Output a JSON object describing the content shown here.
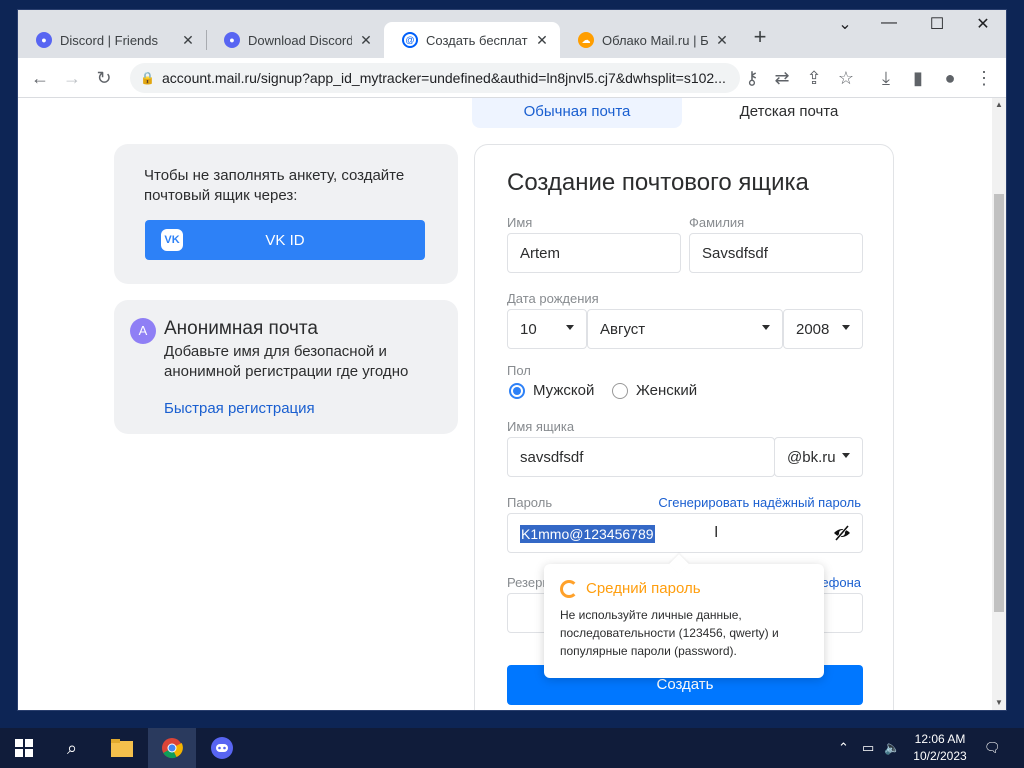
{
  "browser": {
    "tabs": [
      {
        "label": "Discord | Friends",
        "icon": "discord-icon",
        "color": "#5865f2"
      },
      {
        "label": "Download Discord fo",
        "icon": "discord-icon",
        "color": "#5865f2"
      },
      {
        "label": "Создать бесплатну",
        "icon": "mailru-at-icon",
        "color": "#005ff9",
        "active": true
      },
      {
        "label": "Облако Mail.ru | Бе",
        "icon": "cloud-icon",
        "color": "#ff9e00"
      }
    ],
    "new_tab": "+",
    "url": "account.mail.ru/signup?app_id_mytracker=undefined&authid=ln8jnvl5.cj7&dwhsplit=s102..."
  },
  "kind_tabs": {
    "regular": "Обычная почта",
    "kids": "Детская почта"
  },
  "vk_card": {
    "text": "Чтобы не заполнять анкету, создайте почтовый ящик через:",
    "button": "VK ID",
    "logo": "VK"
  },
  "anon_card": {
    "avatar": "A",
    "title": "Анонимная почта",
    "desc": "Добавьте имя для безопасной и анонимной регистрации где угодно",
    "link": "Быстрая регистрация"
  },
  "form": {
    "title": "Создание почтового ящика",
    "first_name_label": "Имя",
    "first_name": "Artem",
    "last_name_label": "Фамилия",
    "last_name": "Savsdfsdf",
    "dob_label": "Дата рождения",
    "dob_day": "10",
    "dob_month": "Август",
    "dob_year": "2008",
    "gender_label": "Пол",
    "gender_male": "Мужской",
    "gender_female": "Женский",
    "mailbox_label": "Имя ящика",
    "mailbox": "savsdfsdf",
    "domain": "@bk.ru",
    "password_label": "Пароль",
    "generate_link": "Сгенерировать надёжный пароль",
    "password": "K1mmo@123456789",
    "reserve_label": "Резерв",
    "phone_link": "ефона",
    "submit": "Создать"
  },
  "tooltip": {
    "title": "Средний пароль",
    "desc": "Не используйте личные данные, последовательности (123456, qwerty) и популярные пароли (password)."
  },
  "taskbar": {
    "time": "12:06 AM",
    "date": "10/2/2023"
  },
  "colors": {
    "accent": "#0077ff",
    "vk": "#2d81f7",
    "warning": "#ff9e0e"
  }
}
